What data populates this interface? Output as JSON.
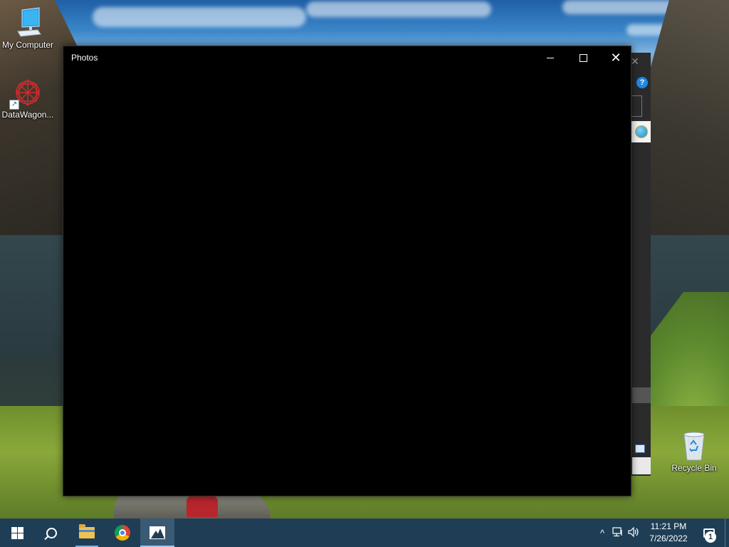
{
  "desktop": {
    "icons": [
      {
        "label": "My Computer",
        "icon": "monitor-icon"
      },
      {
        "label": "DataWagon...",
        "icon": "datawagon-shortcut-icon"
      },
      {
        "label": "Recycle Bin",
        "icon": "recycle-bin-icon"
      }
    ]
  },
  "photos_window": {
    "title": "Photos",
    "controls": {
      "minimize": "minimize-icon",
      "maximize": "maximize-icon",
      "close": "close-icon"
    }
  },
  "background_window": {
    "help_glyph": "?",
    "close_glyph": "✕"
  },
  "taskbar": {
    "apps": [
      {
        "name": "Start",
        "icon": "windows-logo-icon"
      },
      {
        "name": "Search",
        "icon": "search-icon"
      },
      {
        "name": "File Explorer",
        "icon": "folder-icon"
      },
      {
        "name": "Google Chrome",
        "icon": "chrome-icon"
      },
      {
        "name": "Photos",
        "icon": "photos-icon",
        "active": true
      }
    ],
    "tray": {
      "chevron": "^",
      "network_icon": "network-icon",
      "volume_icon": "volume-icon"
    },
    "clock": {
      "time": "11:21 PM",
      "date": "7/26/2022"
    },
    "notifications": {
      "count": "1"
    }
  },
  "colors": {
    "taskbar": "#1f3e56",
    "window_bg": "#000000",
    "accent": "#1e88e5"
  }
}
